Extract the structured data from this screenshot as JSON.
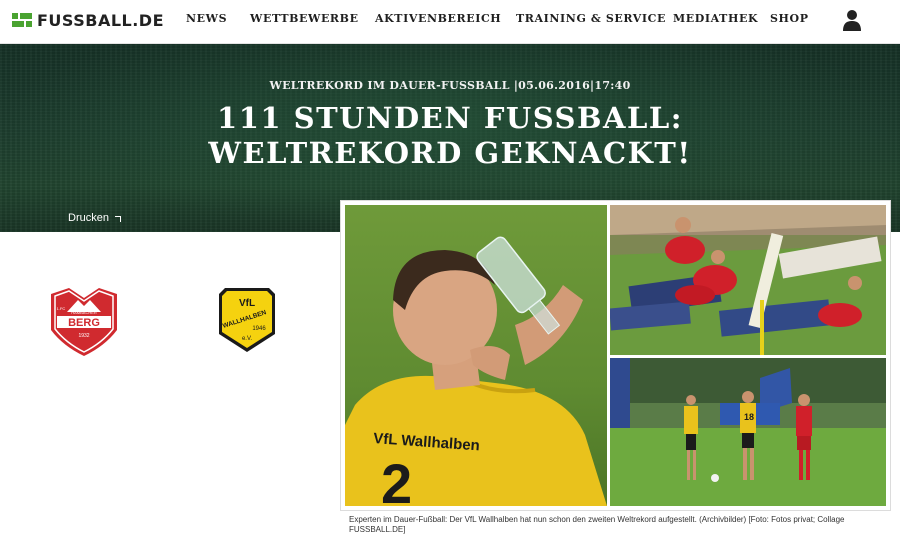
{
  "logo": {
    "text": "FUSSBALL.DE"
  },
  "nav": {
    "items": [
      {
        "label": "NEWS"
      },
      {
        "label": "WETTBEWERBE"
      },
      {
        "label": "AKTIVENBEREICH"
      },
      {
        "label": "TRAINING & SERVICE"
      },
      {
        "label": "MEDIATHEK"
      },
      {
        "label": "SHOP"
      }
    ],
    "user_icon": "user-icon"
  },
  "article": {
    "kicker": "WELTREKORD IM DAUER-FUSSBALL |05.06.2016|17:40",
    "headline_line1": "111 STUNDEN FUSSBALL:",
    "headline_line2": "WELTREKORD GEKNACKT!",
    "print_label": "Drucken",
    "caption": "Experten im Dauer-Fußball: Der VfL Wallhalben hat nun schon den zweiten Weltrekord aufgestellt. (Archivbilder) [Foto: Fotos privat; Collage FUSSBALL.DE]"
  },
  "clubs": {
    "home": {
      "crest_top": "1.FC",
      "crest_small": "HAMBACHER",
      "crest_main": "BERG",
      "crest_bottom": "1932",
      "color": "#d02a2f"
    },
    "away": {
      "crest_top": "VfL",
      "crest_main": "WALLHALBEN",
      "crest_year": "1946",
      "crest_ev": "e.V.",
      "color": "#f5d20f"
    }
  },
  "photos": {
    "jersey_text": "VfL Wallhalben",
    "jersey_number": "2",
    "player_number_right": "18"
  },
  "colors": {
    "brand_green": "#4aa331",
    "hero_green": "#1d3d2e"
  }
}
